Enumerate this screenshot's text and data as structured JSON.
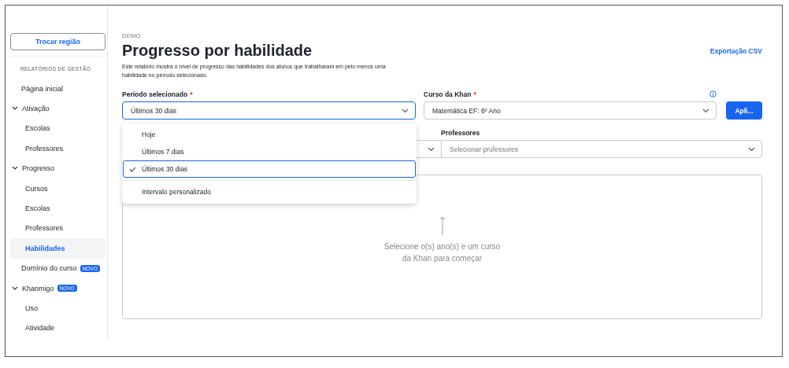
{
  "sidebar": {
    "region_button": "Trocar região",
    "section_title": "RELATÓRIOS DE GESTÃO",
    "items": [
      {
        "label": "Página inicial",
        "selected": false
      },
      {
        "label": "Ativação",
        "expanded": true,
        "selected": false,
        "children": [
          {
            "label": "Escolas",
            "selected": false
          },
          {
            "label": "Professores",
            "selected": false
          }
        ]
      },
      {
        "label": "Progresso",
        "expanded": true,
        "selected": false,
        "children": [
          {
            "label": "Cursos",
            "selected": false
          },
          {
            "label": "Escolas",
            "selected": false
          },
          {
            "label": "Professores",
            "selected": false
          },
          {
            "label": "Habilidades",
            "selected": true
          }
        ]
      },
      {
        "label": "Domínio do curso",
        "badge": "NOVO",
        "selected": false
      },
      {
        "label": "Khanmigo",
        "badge": "NOVO",
        "expanded": true,
        "selected": false,
        "children": [
          {
            "label": "Uso",
            "selected": false
          },
          {
            "label": "Atividade",
            "selected": false
          }
        ]
      }
    ]
  },
  "header": {
    "eyebrow": "DEMO",
    "title": "Progresso por habilidade",
    "description": "Este relatório mostra o nível de progresso das habilidades dos alunos que trabalharam em pelo menos uma habilidade no período selecionado.",
    "export_link": "Exportação CSV"
  },
  "filters": {
    "period": {
      "label": "Período selecionado",
      "required_mark": "*",
      "value": "Últimos 30 dias",
      "open": true,
      "options": [
        {
          "label": "Hoje",
          "selected": false
        },
        {
          "label": "Últimos 7 dias",
          "selected": false
        },
        {
          "label": "Últimos 30 dias",
          "selected": true
        },
        {
          "label": "Intervalo personalizado",
          "selected": false,
          "separated": true
        }
      ]
    },
    "course": {
      "label": "Curso da Khan",
      "required_mark": "*",
      "value": "Matemática EF: 6º Ano",
      "info": true
    },
    "apply_button": "Apli...",
    "teachers": {
      "label": "Professores",
      "placeholder": "Selecionar professores"
    }
  },
  "empty_state": {
    "message": "Selecione o(s) ano(s) e um curso da Khan para começar"
  }
}
